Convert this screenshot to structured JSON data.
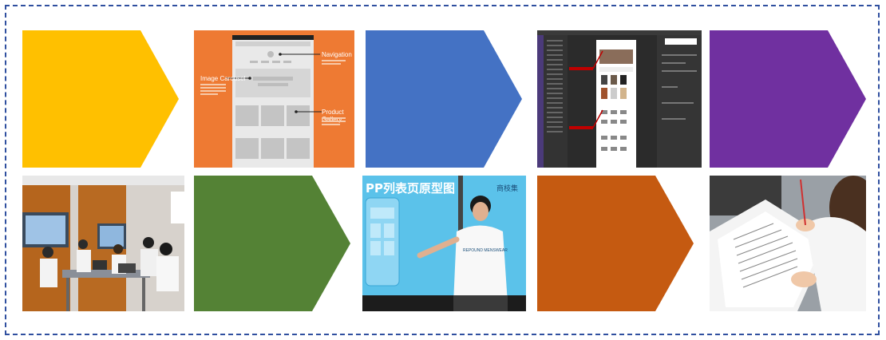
{
  "colors": {
    "border": "#2f4f9f",
    "yellow": "#ffc000",
    "blue": "#4472c4",
    "purple": "#7030a0",
    "green": "#548235",
    "orange": "#c55a11",
    "wireframe_bg": "#ee7a33"
  },
  "wireframe": {
    "navigation": "Navigation",
    "image_carousel": "Image Carousel",
    "product_gallery": "Product Gallery"
  },
  "presentation": {
    "slide_title": "PP列表页原型图",
    "slide_side": "商枝集",
    "shirt_text": "REPOUND MENSWEAR"
  }
}
